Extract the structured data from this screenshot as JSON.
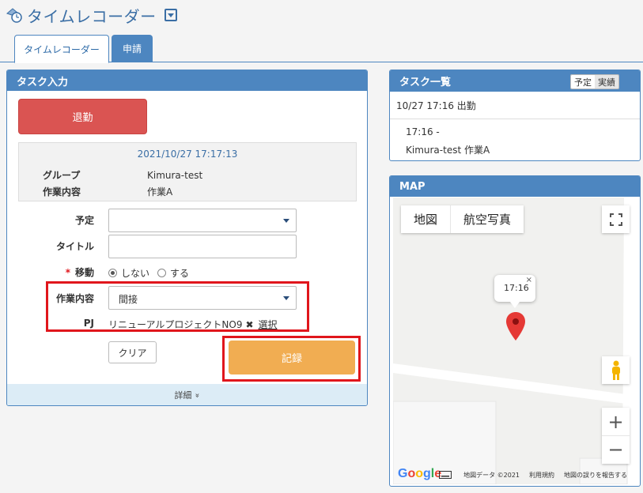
{
  "app": {
    "title": "タイムレコーダー"
  },
  "tabs": [
    {
      "label": "タイムレコーダー",
      "active": true
    },
    {
      "label": "申請",
      "active": false
    }
  ],
  "task_input": {
    "header": "タスク入力",
    "leave_button": "退勤",
    "info": {
      "datetime": "2021/10/27 17:17:13",
      "group_label": "グループ",
      "group_value": "Kimura-test",
      "work_label": "作業内容",
      "work_value": "作業A"
    },
    "form": {
      "plan_label": "予定",
      "plan_value": "",
      "title_label": "タイトル",
      "title_value": "",
      "move_required_mark": "*",
      "move_label": "移動",
      "move_options": [
        "しない",
        "する"
      ],
      "move_selected": "しない",
      "work_label": "作業内容",
      "work_value": "間接",
      "pj_label": "PJ",
      "pj_value": "リニューアルプロジェクトNO9",
      "pj_remove": "✖",
      "pj_select": "選択",
      "clear_button": "クリア",
      "record_button": "記録"
    },
    "detail_toggle": "詳細",
    "detail_chevron": "»"
  },
  "task_list": {
    "header": "タスク一覧",
    "switch": [
      "予定",
      "実績"
    ],
    "switch_selected": "予定",
    "row": "10/27 17:16 出勤",
    "detail_time": "17:16 -",
    "detail_text": "Kimura-test 作業A"
  },
  "map": {
    "header": "MAP",
    "type_buttons": [
      "地図",
      "航空写真"
    ],
    "popup_time": "17:16",
    "popup_close": "×",
    "zoom_in": "+",
    "zoom_out": "−",
    "google_logo": [
      "G",
      "o",
      "o",
      "g",
      "l",
      "e"
    ],
    "footer": [
      "地図データ ©2021",
      "利用規約",
      "地図の誤りを報告する"
    ]
  },
  "colors": {
    "primary": "#4d86c0",
    "leave": "#da5452",
    "record": "#f1ad52",
    "highlight": "#e0161c",
    "detail_bar": "#dcecf6",
    "pin": "#e53935"
  }
}
